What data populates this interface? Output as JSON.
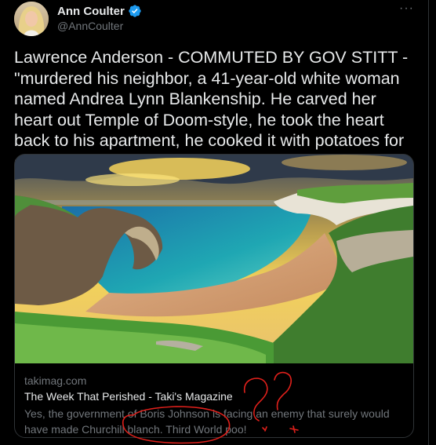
{
  "author": {
    "display_name": "Ann Coulter",
    "handle": "@AnnCoulter"
  },
  "icons": {
    "verified": "verified-badge-icon",
    "more": "more-options-icon"
  },
  "more_label": "···",
  "tweet": {
    "text": "Lawrence Anderson - COMMUTED BY GOV STITT - \"murdered his neighbor, a 41-year-old white woman named Andrea Lynn Blankenship. He carved her heart out Temple of Doom-style, he took the heart back to his apartment, he cooked it with potatoes for dinner..\""
  },
  "card": {
    "domain": "takimag.com",
    "title": "The Week That Perished - Taki's Magazine",
    "description": "Yes, the government of Boris Johnson is facing an enemy that surely would have made Churchill blanch. Third World poo!"
  },
  "colors": {
    "background": "#000000",
    "text": "#e7e9ea",
    "secondary": "#71767b",
    "verified": "#1d9bf0",
    "annotation": "#e0201b"
  }
}
